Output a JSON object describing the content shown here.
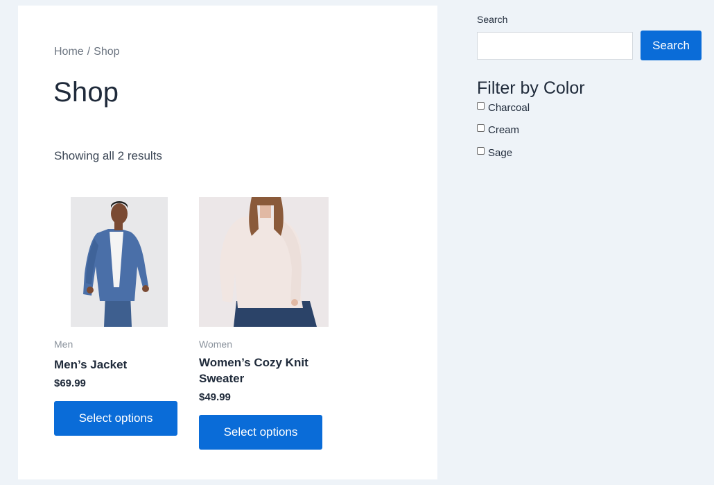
{
  "breadcrumb": {
    "home": "Home",
    "separator": "/",
    "current": "Shop"
  },
  "page": {
    "title": "Shop",
    "result_count": "Showing all 2 results"
  },
  "products": [
    {
      "category": "Men",
      "name": "Men’s Jacket",
      "price": "$69.99",
      "button_label": "Select options",
      "image": "man-in-denim-jacket-photo"
    },
    {
      "category": "Women",
      "name": "Women’s Cozy Knit Sweater",
      "price": "$49.99",
      "button_label": "Select options",
      "image": "woman-in-knit-sweater-photo"
    }
  ],
  "sidebar": {
    "search": {
      "label": "Search",
      "value": "",
      "placeholder": "",
      "button_label": "Search"
    },
    "filter": {
      "title": "Filter by Color",
      "options": [
        {
          "label": "Charcoal",
          "checked": false
        },
        {
          "label": "Cream",
          "checked": false
        },
        {
          "label": "Sage",
          "checked": false
        }
      ]
    }
  },
  "colors": {
    "accent": "#0a6cd8",
    "background": "#eef3f8",
    "card": "#ffffff",
    "text": "#1f2a3a",
    "muted": "#8a929c"
  }
}
